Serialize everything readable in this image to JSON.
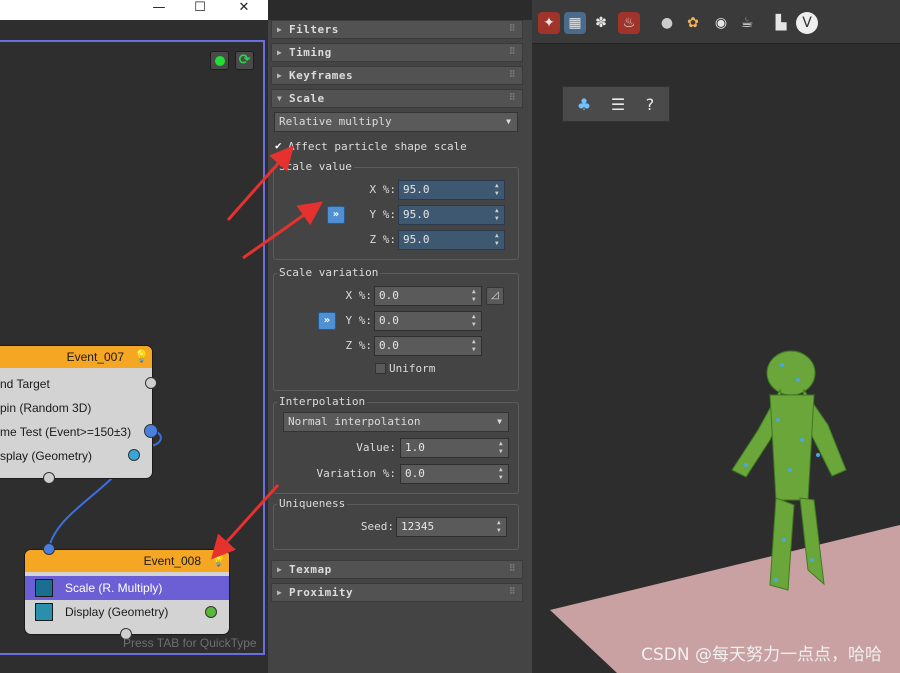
{
  "titlebar": {
    "minimize": "—",
    "maximize": "☐",
    "close": "✕"
  },
  "graph": {
    "buttons": [
      {
        "icon": "green-dot-icon"
      },
      {
        "icon": "refresh-cycle-icon"
      }
    ],
    "event_007": {
      "title": "Event_007",
      "rows": [
        {
          "label": "nd Target"
        },
        {
          "label": "pin (Random 3D)"
        },
        {
          "label": "me Test (Event>=150±3)"
        },
        {
          "label": "splay (Geometry)"
        }
      ]
    },
    "event_008": {
      "title": "Event_008",
      "rows": [
        {
          "label": "Scale (R. Multiply)"
        },
        {
          "label": "Display (Geometry)"
        }
      ]
    },
    "hint": "Press TAB for QuickType"
  },
  "panel": {
    "rollouts": {
      "filters": "Filters",
      "timing": "Timing",
      "keyframes": "Keyframes",
      "scale": "Scale",
      "texmap": "Texmap",
      "proximity": "Proximity"
    },
    "scale_type": "Relative multiply",
    "affect_shape": {
      "label": "Affect particle shape scale",
      "checked": true
    },
    "scale_value": {
      "title": "Scale value",
      "x_label": "X %:",
      "x": "95.0",
      "y_label": "Y %:",
      "y": "95.0",
      "z_label": "Z %:",
      "z": "95.0"
    },
    "scale_variation": {
      "title": "Scale variation",
      "x_label": "X %:",
      "x": "0.0",
      "y_label": "Y %:",
      "y": "0.0",
      "z_label": "Z %:",
      "z": "0.0",
      "uniform": "Uniform"
    },
    "interpolation": {
      "title": "Interpolation",
      "mode": "Normal interpolation",
      "value_label": "Value:",
      "value": "1.0",
      "variation_label": "Variation %:",
      "variation": "0.0"
    },
    "uniqueness": {
      "title": "Uniqueness",
      "seed_label": "Seed:",
      "seed": "12345"
    }
  },
  "viewport": {
    "watermark": "CSDN @每天努力一点点，哈哈",
    "colors": {
      "floor": "#c9a1a2",
      "foliage": "#6aa63a",
      "arrow": "#e6322e"
    }
  }
}
